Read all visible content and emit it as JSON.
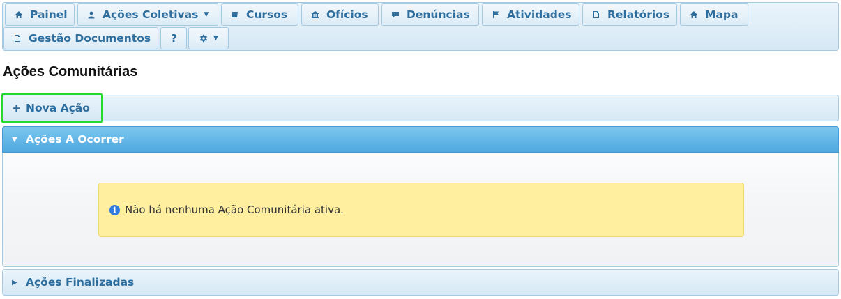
{
  "menu": {
    "items": [
      {
        "label": "Painel",
        "icon": "home-icon"
      },
      {
        "label": "Ações Coletivas",
        "icon": "user-icon",
        "dropdown": true
      },
      {
        "label": "Cursos",
        "icon": "course-icon"
      },
      {
        "label": "Ofícios",
        "icon": "building-icon"
      },
      {
        "label": "Denúncias",
        "icon": "comment-icon"
      },
      {
        "label": "Atividades",
        "icon": "flag-icon"
      },
      {
        "label": "Relatórios",
        "icon": "document-icon"
      },
      {
        "label": "Mapa",
        "icon": "home-icon"
      },
      {
        "label": "Gestão Documentos",
        "icon": "document-icon"
      }
    ],
    "help_label": "?",
    "settings_icon": "gear-icon"
  },
  "page": {
    "title": "Ações Comunitárias"
  },
  "accordion": {
    "new_action_label": "Nova Ação",
    "upcoming_label": "Ações A Ocorrer",
    "finished_label": "Ações Finalizadas",
    "empty_message": "Não há nenhuma Ação Comunitária ativa."
  },
  "colors": {
    "accent": "#2e6e9e",
    "active_header": "#4fa8de",
    "alert_bg": "#ffef9f",
    "focus_ring": "#26d92f"
  }
}
